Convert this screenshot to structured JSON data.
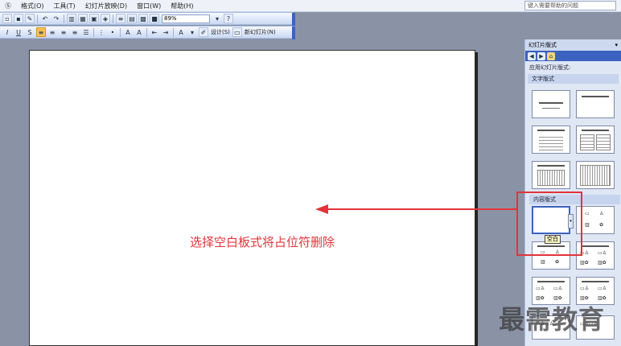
{
  "menu": {
    "items": [
      "Ⓢ",
      "格式(O)",
      "工具(T)",
      "幻灯片放映(D)",
      "窗口(W)",
      "帮助(H)"
    ],
    "help_placeholder": "键入需要帮助的问题"
  },
  "toolbar": {
    "zoom": "89%",
    "design_label": "设计(S)",
    "new_slide_label": "新幻灯片(N)"
  },
  "slide": {
    "instruction": "选择空白板式将占位符删除"
  },
  "task_pane": {
    "title": "幻灯片版式",
    "apply_label": "应用幻灯片版式:",
    "text_layouts_header": "文字版式",
    "content_layouts_header": "内容版式",
    "selected_tooltip": "空白"
  },
  "watermark": "最需教育",
  "colors": {
    "annotation_red": "#e2343a",
    "toolbar_blue": "#3b62c0"
  }
}
